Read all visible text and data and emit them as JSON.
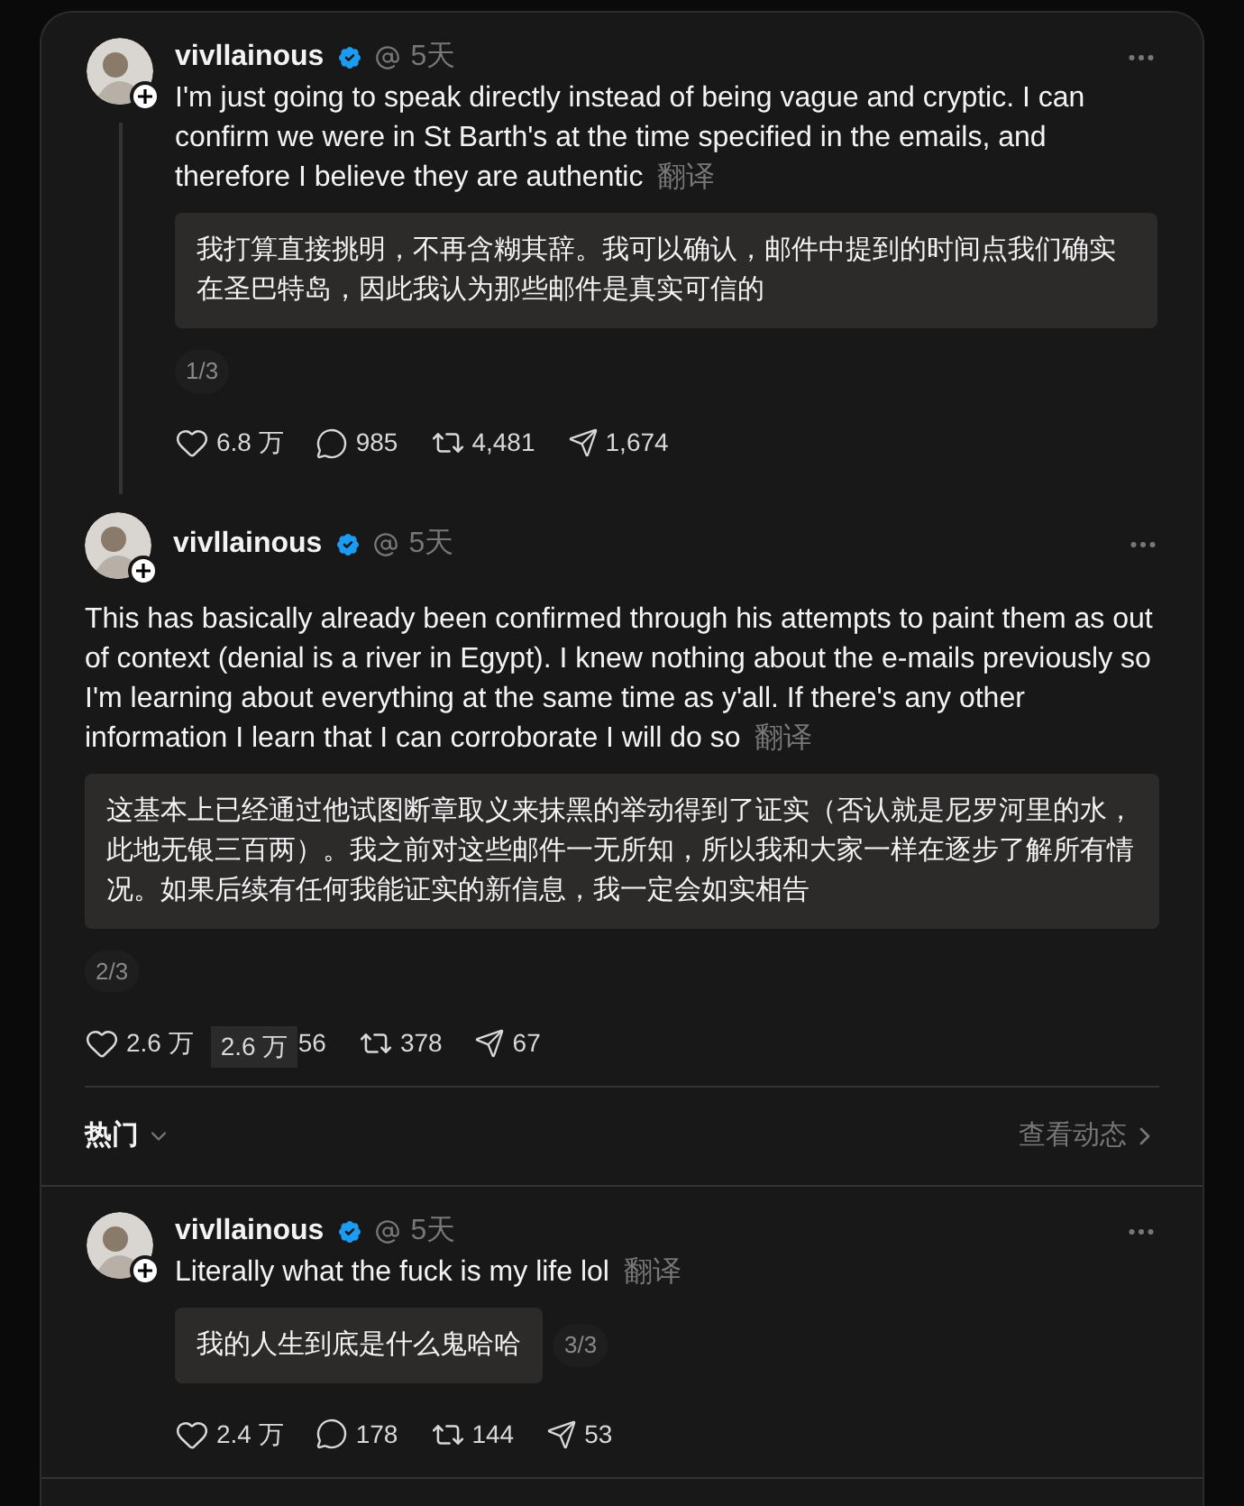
{
  "posts": [
    {
      "kind": "thread",
      "author": "vivllainous",
      "verified": true,
      "time": "5天",
      "text": "I'm just going to speak directly instead of being vague and cryptic. I can confirm we were in St Barth's at the time specified in the emails, and therefore I believe they are authentic",
      "translate_label": "翻译",
      "translation": "我打算直接挑明，不再含糊其辞。我可以确认，邮件中提到的时间点我们确实在圣巴特岛，因此我认为那些邮件是真实可信的",
      "page_badge": "1/3",
      "stats": {
        "likes": "6.8 万",
        "replies": "985",
        "reposts": "4,481",
        "shares": "1,674"
      }
    },
    {
      "kind": "continued",
      "author": "vivllainous",
      "verified": true,
      "time": "5天",
      "text": "This has basically already been confirmed through his attempts to paint them as out of context (denial is a river in Egypt). I knew nothing about the e-mails previously so I'm learning about everything at the same time as y'all. If there's any other information I learn that I can corroborate I will do so",
      "translate_label": "翻译",
      "translation": "这基本上已经通过他试图断章取义来抹黑的举动得到了证实（否认就是尼罗河里的水，此地无银三百两）。我之前对这些邮件一无所知，所以我和大家一样在逐步了解所有情况。如果后续有任何我能证实的新信息，我一定会如实相告",
      "page_badge": "2/3",
      "stats": {
        "likes": "2.6 万",
        "tooltip": "2.6 万",
        "replies": "56",
        "reposts": "378",
        "shares": "67"
      }
    }
  ],
  "sort_bar": {
    "label": "热门",
    "link": "查看动态"
  },
  "reply": {
    "kind": "reply",
    "author": "vivllainous",
    "verified": true,
    "time": "5天",
    "text": "Literally what the fuck is my life lol",
    "translate_label": "翻译",
    "translation": "我的人生到底是什么鬼哈哈",
    "page_badge": "3/3",
    "stats": {
      "likes": "2.4 万",
      "replies": "178",
      "reposts": "144",
      "shares": "53"
    }
  }
}
